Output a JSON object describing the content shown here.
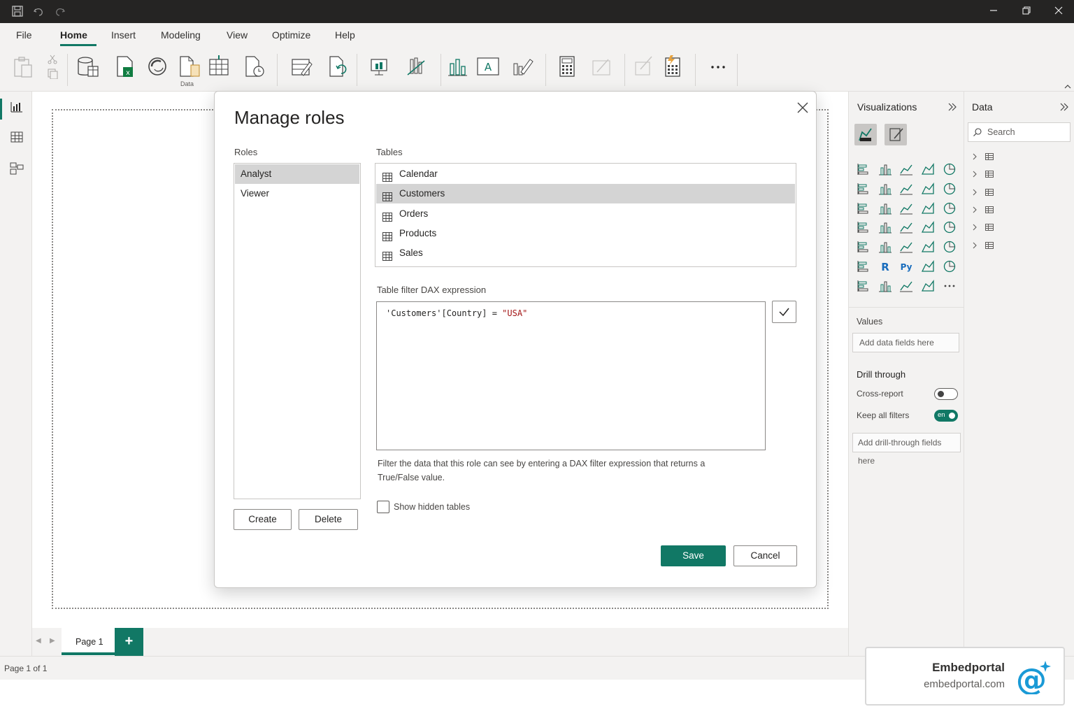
{
  "menu": {
    "items": [
      "File",
      "Home",
      "Insert",
      "Modeling",
      "View",
      "Optimize",
      "Help"
    ],
    "active": "Home"
  },
  "ribbon": {
    "group_label": "Data"
  },
  "dialog": {
    "title": "Manage roles",
    "roles_label": "Roles",
    "roles": [
      "Analyst",
      "Viewer"
    ],
    "selected_role": "Analyst",
    "tables_label": "Tables",
    "tables": [
      "Calendar",
      "Customers",
      "Orders",
      "Products",
      "Sales"
    ],
    "selected_table": "Customers",
    "dax_label": "Table filter DAX expression",
    "dax_part1": "'Customers'[Country] = ",
    "dax_part2": "\"USA\"",
    "help_line1": "Filter the data that this role can see by entering a DAX filter expression that returns a",
    "help_line2": "True/False value.",
    "show_hidden_label": "Show hidden tables",
    "create_label": "Create",
    "delete_label": "Delete",
    "save_label": "Save",
    "cancel_label": "Cancel"
  },
  "viz_pane": {
    "title": "Visualizations",
    "values_label": "Values",
    "values_placeholder": "Add data fields here",
    "drill_label": "Drill through",
    "cross_report_label": "Cross-report",
    "keep_filters_label": "Keep all filters",
    "keep_filters_toggle_text": "en",
    "drill_placeholder": "Add drill-through fields here"
  },
  "data_pane": {
    "title": "Data",
    "search_placeholder": "Search"
  },
  "pages": {
    "tab_label": "Page 1",
    "add_label": "+"
  },
  "status": {
    "page_count": "Page 1 of 1"
  },
  "watermark": {
    "brand": "Embedportal",
    "url": "embedportal.com"
  },
  "colors": {
    "accent": "#117865",
    "titlebar": "#252423",
    "selection": "#d4d4d4",
    "dax_string": "#a31515"
  }
}
